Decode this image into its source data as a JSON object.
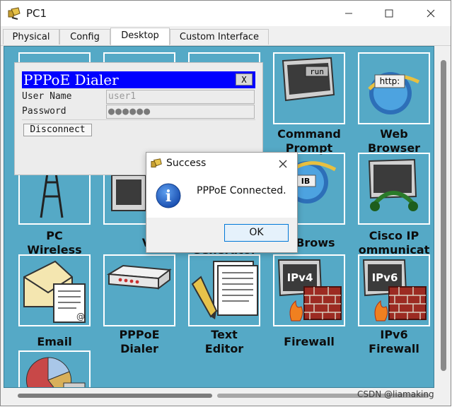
{
  "window": {
    "title": "PC1",
    "minimize_glyph": "—",
    "maximize_glyph": "☐",
    "close_glyph": "✕"
  },
  "tabs": [
    {
      "label": "Physical"
    },
    {
      "label": "Config"
    },
    {
      "label": "Desktop",
      "active": true
    },
    {
      "label": "Custom Interface"
    }
  ],
  "desktop": {
    "background": "#55a9c6",
    "apps": [
      {
        "label_lines": [
          "Command",
          "Prompt"
        ],
        "icon": "terminal-icon",
        "icon_text": "run"
      },
      {
        "label_lines": [
          "Web",
          "Browser"
        ],
        "icon": "browser-icon",
        "icon_text": "http:"
      },
      {
        "label_lines": [
          "PC",
          "Wireless"
        ],
        "icon": "wireless-icon"
      },
      {
        "label_lines": [
          "V"
        ],
        "icon": "vpn-icon"
      },
      {
        "label_lines": [
          "Generator"
        ],
        "icon": "traffic-generator-icon"
      },
      {
        "label_lines": [
          "B Brows"
        ],
        "icon": "mib-browser-icon",
        "icon_text": "IB"
      },
      {
        "label_lines": [
          "Cisco IP",
          "ommunicat"
        ],
        "icon": "ip-communicator-icon"
      },
      {
        "label_lines": [
          "Email"
        ],
        "icon": "email-icon"
      },
      {
        "label_lines": [
          "PPPoE",
          "Dialer"
        ],
        "icon": "pppoe-dialer-icon"
      },
      {
        "label_lines": [
          "Text",
          "Editor"
        ],
        "icon": "text-editor-icon"
      },
      {
        "label_lines": [
          "Firewall"
        ],
        "icon": "firewall-icon",
        "icon_text": "IPv4"
      },
      {
        "label_lines": [
          "IPv6",
          "Firewall"
        ],
        "icon": "ipv6-firewall-icon",
        "icon_text": "IPv6"
      },
      {
        "label_lines": [],
        "icon": "chart-icon"
      }
    ]
  },
  "dialer": {
    "title": "PPPoE Dialer",
    "close_label": "X",
    "username_label": "User Name",
    "username_value": "user1",
    "password_label": "Password",
    "password_value": "●●●●●●",
    "disconnect_label": "Disconnect",
    "header_color": "#0000ff"
  },
  "message_box": {
    "title": "Success",
    "text": "PPPoE Connected.",
    "ok_label": "OK",
    "close_glyph": "✕",
    "icon": "info-icon",
    "icon_glyph": "i"
  },
  "watermark": "CSDN @liamaking"
}
